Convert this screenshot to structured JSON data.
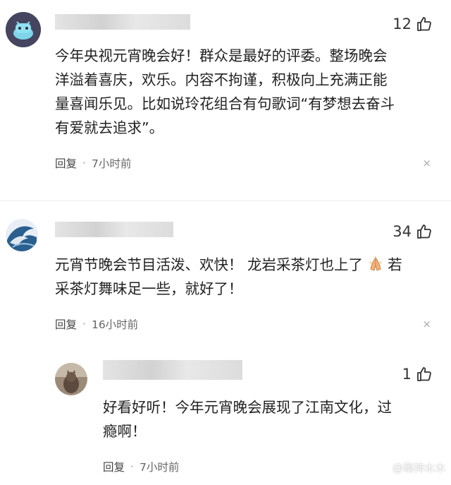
{
  "comments": [
    {
      "likes": "12",
      "text_lines": [
        "今年央视元宵晚会好！群众是最好的评委。整场晚会",
        "洋溢着喜庆，欢乐。内容不拘谨，积极向上充满正能",
        "量喜闻乐见。比如说玲花组合有句歌词“有梦想去奋斗",
        "有爱就去追求”。"
      ],
      "reply": "回复",
      "time": "7小时前",
      "close": "×"
    },
    {
      "likes": "34",
      "text_line1_a": "元宵节晚会节目活泼、欢快！ 龙岩采茶灯也上了",
      "text_line1_b": "若",
      "text_line2": "采茶灯舞味足一些，就好了！",
      "reply": "回复",
      "time": "16小时前",
      "close": "×"
    },
    {
      "likes": "1",
      "text_lines": [
        "好看好听！今年元宵晚会展现了江南文化，过",
        "瘾啊！"
      ],
      "reply": "回复",
      "time": "7小时前"
    }
  ],
  "watermark": "@萌神木木",
  "icons": [
    "thumbs-up-icon",
    "close-icon",
    "folded-hands-emoji",
    "avatar"
  ]
}
